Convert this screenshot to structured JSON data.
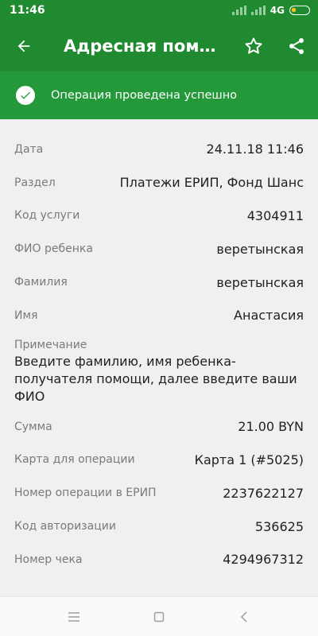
{
  "status_bar": {
    "time": "11:46",
    "network": "4G"
  },
  "app_bar": {
    "title": "Адресная помощ…"
  },
  "banner": {
    "message": "Операция проведена успешно"
  },
  "details": [
    {
      "label": "Дата",
      "value": "24.11.18 11:46"
    },
    {
      "label": "Раздел",
      "value": "Платежи ЕРИП, Фонд Шанс"
    },
    {
      "label": "Код услуги",
      "value": "4304911"
    },
    {
      "label": "ФИО ребенка",
      "value": "веретынская"
    },
    {
      "label": "Фамилия",
      "value": "веретынская"
    },
    {
      "label": "Имя",
      "value": "Анастасия"
    }
  ],
  "note": {
    "label": "Примечание",
    "value": "Введите фамилию, имя ребенка-получателя помощи, далее введите ваши ФИО"
  },
  "details2": [
    {
      "label": "Сумма",
      "value": "21.00 BYN"
    },
    {
      "label": "Карта для операции",
      "value": "Карта 1 (#5025)"
    },
    {
      "label": "Номер операции в ЕРИП",
      "value": "2237622127"
    },
    {
      "label": "Код авторизации",
      "value": "536625"
    },
    {
      "label": "Номер чека",
      "value": "4294967312"
    }
  ],
  "colors": {
    "primary": "#1f8a2f",
    "banner": "#23993a",
    "battery": "#f5c518"
  }
}
